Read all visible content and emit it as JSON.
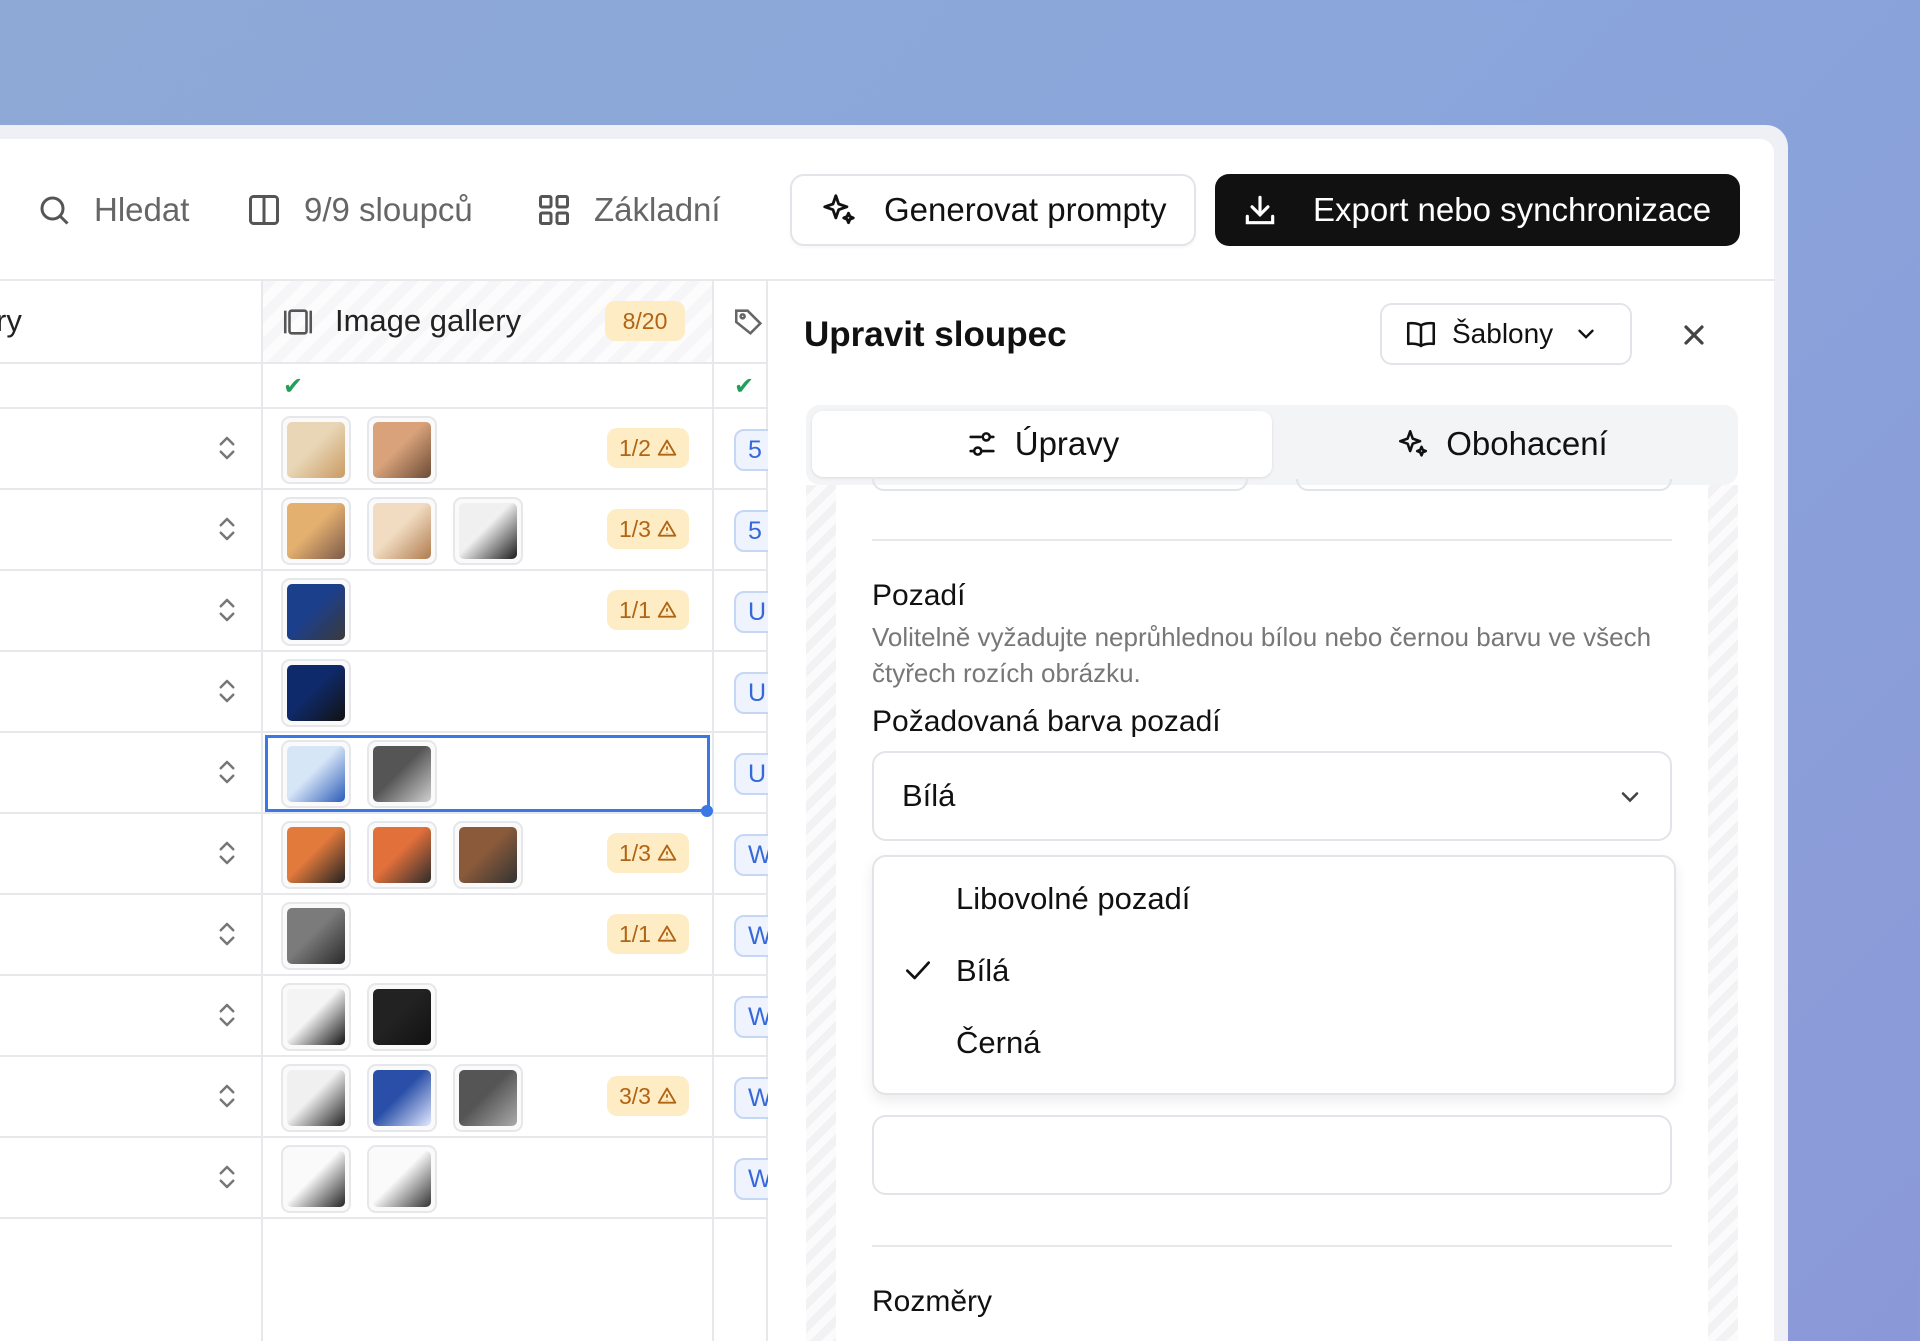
{
  "toolbar": {
    "search_label": "Hledat",
    "columns_label": "9/9 sloupců",
    "view_label": "Základní",
    "generate_label": "Generovat prompty",
    "export_label": "Export nebo synchronizace"
  },
  "table": {
    "col_a_header_fragment": "ry",
    "gallery_header": "Image gallery",
    "gallery_count": "8/20",
    "check_mark": "✔",
    "rows": [
      {
        "warn": "1/2",
        "pill": "5"
      },
      {
        "warn": "1/3",
        "pill": "5"
      },
      {
        "warn": "1/1",
        "pill": "U"
      },
      {
        "warn": "",
        "pill": "U"
      },
      {
        "warn": "",
        "pill": "U"
      },
      {
        "warn": "1/3",
        "pill": "W"
      },
      {
        "warn": "1/1",
        "pill": "W"
      },
      {
        "warn": "",
        "pill": "W"
      },
      {
        "warn": "3/3",
        "pill": "W"
      },
      {
        "warn": "",
        "pill": "W"
      }
    ]
  },
  "panel": {
    "title": "Upravit sloupec",
    "templates_label": "Šablony",
    "tabs": [
      {
        "label": "Úpravy",
        "icon": "sliders-icon",
        "active": true
      },
      {
        "label": "Obohacení",
        "icon": "sparkles-icon",
        "active": false
      }
    ],
    "background_section": {
      "title": "Pozadí",
      "description": "Volitelně vyžadujte neprůhlednou bílou nebo černou barvu ve všech čtyřech rozích obrázku."
    },
    "required_color": {
      "label": "Požadovaná barva pozadí",
      "value": "Bílá",
      "options": [
        "Libovolné pozadí",
        "Bílá",
        "Černá"
      ],
      "selected_index": 1
    },
    "dimensions_section": {
      "title": "Rozměry"
    }
  },
  "colors": {
    "accent_blue": "#3a78e6",
    "warn_bg": "#fdecc4",
    "warn_text": "#b06414",
    "check_green": "#22a05a",
    "export_bg": "#111111"
  }
}
